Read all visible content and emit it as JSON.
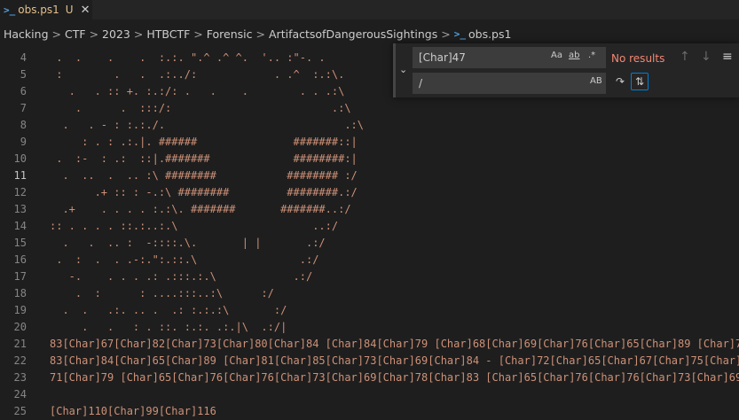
{
  "tab": {
    "label": "obs.ps1",
    "status": "U",
    "close": "✕"
  },
  "breadcrumb": {
    "items": [
      "Hacking",
      "CTF",
      "2023",
      "HTBCTF",
      "Forensic",
      "ArtifactsofDangerousSightings"
    ],
    "file": "obs.ps1",
    "separator": ">"
  },
  "editor": {
    "active_line": 11,
    "lines": [
      {
        "n": 4,
        "text": " .  .    .    .  :.:. \".^ .^ ^.  '.. :\"-. ."
      },
      {
        "n": 5,
        "text": " :        .   .  .:../:            . .^  :.:\\."
      },
      {
        "n": 6,
        "text": "   .   . :: +. :.:/: .   .    .        . . .:\\"
      },
      {
        "n": 7,
        "text": "    .      .  :::/:                         .:\\"
      },
      {
        "n": 8,
        "text": "  .   . - : :.:./.                            .:\\"
      },
      {
        "n": 9,
        "text": "     : . : .:.|. ######               #######::|"
      },
      {
        "n": 10,
        "text": " .  :-  : .:  ::|.#######             ########:|"
      },
      {
        "n": 11,
        "text": "  .  ..  .  .. :\\ ########           ######## :/"
      },
      {
        "n": 12,
        "text": "       .+ :: : -.:\\ ########         ########.:/"
      },
      {
        "n": 13,
        "text": "  .+    . . . . :.:\\. #######       #######..:/"
      },
      {
        "n": 14,
        "text": ":: . . . . ::.:..:.\\                     ..:/"
      },
      {
        "n": 15,
        "text": "  .   .  .. :  -::::.\\.       | |       .:/"
      },
      {
        "n": 16,
        "text": " .  :  .  . .-:.\":.::.\\                .:/"
      },
      {
        "n": 17,
        "text": "   -.    . . . .: .:::.:.\\            .:/"
      },
      {
        "n": 18,
        "text": "    .  :      : ....:::..:\\      :/"
      },
      {
        "n": 19,
        "text": "  .  .   .:. .. .  .: :.:.:\\       :/"
      },
      {
        "n": 20,
        "text": "     .   .   : . ::. :.:. .:.|\\  .:/|"
      },
      {
        "n": 21,
        "text": "83[Char]67[Char]82[Char]73[Char]80[Char]84 [Char]84[Char]79 [Char]68[Char]69[Char]76[Char]65[Char]89 [Char]7"
      },
      {
        "n": 22,
        "text": "83[Char]84[Char]65[Char]89 [Char]81[Char]85[Char]73[Char]69[Char]84 - [Char]72[Char]65[Char]67[Char]75[Char]"
      },
      {
        "n": 23,
        "text": "71[Char]79 [Char]65[Char]76[Char]76[Char]73[Char]69[Char]78[Char]83 [Char]65[Char]76[Char]76[Char]73[Char]69"
      },
      {
        "n": 24,
        "text": ""
      },
      {
        "n": 25,
        "text": "[Char]110[Char]99[Char]116"
      }
    ]
  },
  "find_widget": {
    "find_value": "[Char]47",
    "replace_value": "/",
    "match_case_label": "Aa",
    "whole_word_label": "ab",
    "regex_label": ".*",
    "preserve_case_label": "AB",
    "no_results": "No results",
    "toggle_icon": "chevron-down-icon",
    "prev_icon": "arrow-up-icon",
    "next_icon": "arrow-down-icon",
    "selection_icon": "find-in-selection-icon",
    "replace_icon": "replace-icon",
    "replace_all_icon": "replace-all-icon"
  },
  "colors": {
    "editor_bg": "#1e1e1e",
    "string": "#ce9178",
    "line_number": "#858585",
    "tab_modified": "#e2c08d",
    "no_results": "#f48771",
    "focus_border": "#007fd4"
  }
}
